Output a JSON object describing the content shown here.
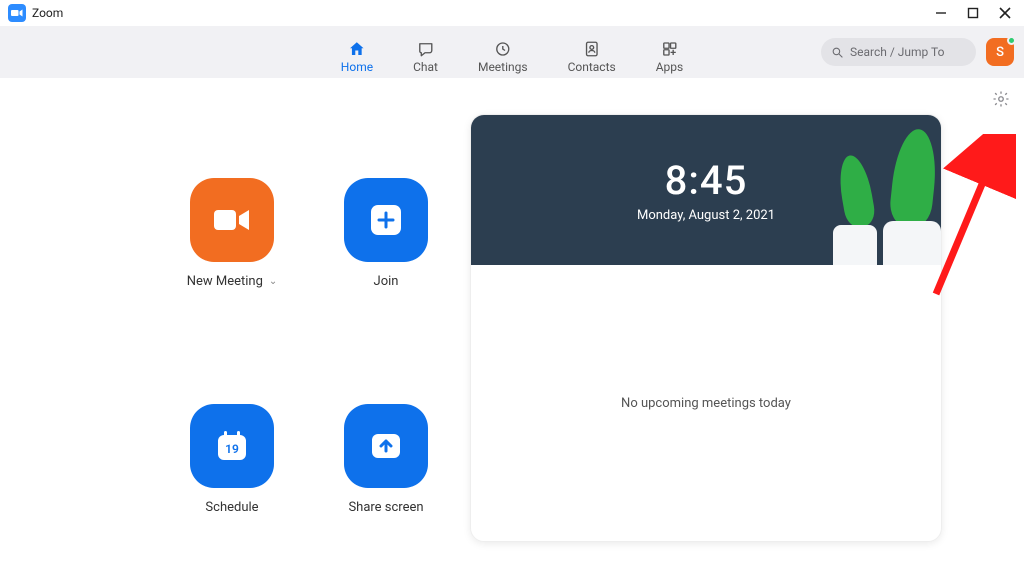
{
  "app": {
    "title": "Zoom"
  },
  "nav": {
    "home": "Home",
    "chat": "Chat",
    "meetings": "Meetings",
    "contacts": "Contacts",
    "apps": "Apps"
  },
  "search": {
    "placeholder": "Search / Jump To"
  },
  "avatar": {
    "initial": "S"
  },
  "actions": {
    "new_meeting": "New Meeting",
    "join": "Join",
    "schedule": "Schedule",
    "schedule_day": "19",
    "share_screen": "Share screen"
  },
  "panel": {
    "time": "8:45",
    "date": "Monday, August 2, 2021",
    "empty": "No upcoming meetings today"
  }
}
